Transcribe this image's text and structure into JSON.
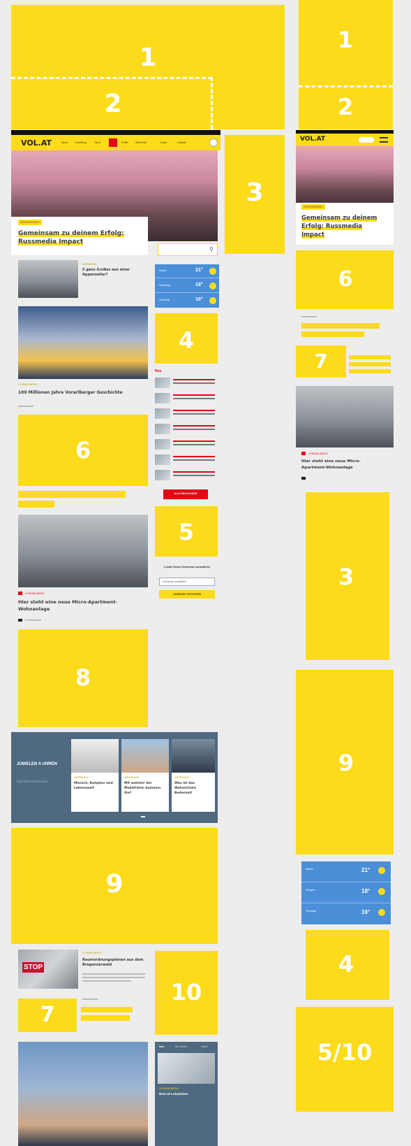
{
  "colors": {
    "accent_yellow": "#fcdb1a",
    "page_bg": "#ededed",
    "slate_teaser": "#4e6980",
    "weather_blue": "#4a8fd8",
    "alert_red": "#e30613"
  },
  "slots": {
    "left_1": "1",
    "left_2": "2",
    "left_3": "3",
    "left_4": "4",
    "left_5": "5",
    "left_6": "6",
    "left_7": "7",
    "left_8": "8",
    "left_9": "9",
    "left_10": "10",
    "right_1": "1",
    "right_2": "2",
    "right_6": "6",
    "right_7": "7",
    "right_3": "3",
    "right_9": "9",
    "right_4": "4",
    "right_5_10": "5/10"
  },
  "desktop": {
    "logo": "VOL.AT",
    "nav_items": [
      "News",
      "Vorarlberg",
      "Sport",
      "Politik",
      "Wirtschaft",
      "Kultur",
      "Lifestyle"
    ],
    "hero_tag": "GESPONSERT",
    "hero_title": "Gemeinsam zu deinem Erfolg: Russmedia Impact",
    "teaser1_title": "5 ganz Großes aus einer Appenzeller?",
    "teaser1_tag": "WERBUNG",
    "story_tag": "VORARLBERG",
    "story_title": "100 Millionen Jahre Vorarlberger Geschichte",
    "micro_tag": "VORARLBERG",
    "micro_title": "Hier steht eine neue Micro-Apartment-Wohnanlage",
    "micro_comments": "17 Kommentare",
    "weather": [
      {
        "day": "Heute",
        "temp": "21°"
      },
      {
        "day": "Samstag",
        "temp": "18°"
      },
      {
        "day": "Sonntag",
        "temp": "16°"
      }
    ],
    "news_header": "Neu",
    "news_more": "ALLE MELDUNGEN",
    "region_title": "Lokale News-Gemeinde auswählen",
    "region_input": "Gemeinde auswählen",
    "region_button": "GEMEINDE SPEICHERN",
    "jewels_title": "JUWELEN A UNREN",
    "jewels_sub": "WEITERE ENTDECKEN",
    "jewel_cards": [
      {
        "tag": "WERBUNG",
        "title": "Mensch, Komplex und Lebenswelt"
      },
      {
        "tag": "WERBUNG",
        "title": "Mit welcher der Mobilitäten kommen Sie?"
      },
      {
        "tag": "WERBUNG",
        "title": "Was ist das Wohnlichste Bodenzeit"
      }
    ],
    "stop_tag": "VORARLBERG",
    "stop_title": "Raumordnungsplanen aus dem Bregenzerwald",
    "stop_sign": "STOP",
    "bottom_tabs": [
      "Neu",
      "Top-Klicks",
      "Sport"
    ],
    "bottom_tag": "VORARLBERG",
    "bottom_title": "Best-of-Lokalzeiten"
  },
  "mobile": {
    "logo": "VOL.AT",
    "hero_tag": "GESPONSERT",
    "hero_title": "Gemeinsam zu deinem Erfolg: Russmedia Impact",
    "micro_tag": "VORARLBERG",
    "micro_title": "Hier steht eine neue Micro-Apartment-Wohnanlage",
    "weather": [
      {
        "day": "Heute",
        "temp": "21°"
      },
      {
        "day": "Morgen",
        "temp": "18°"
      },
      {
        "day": "Sonntag",
        "temp": "16°"
      }
    ]
  }
}
